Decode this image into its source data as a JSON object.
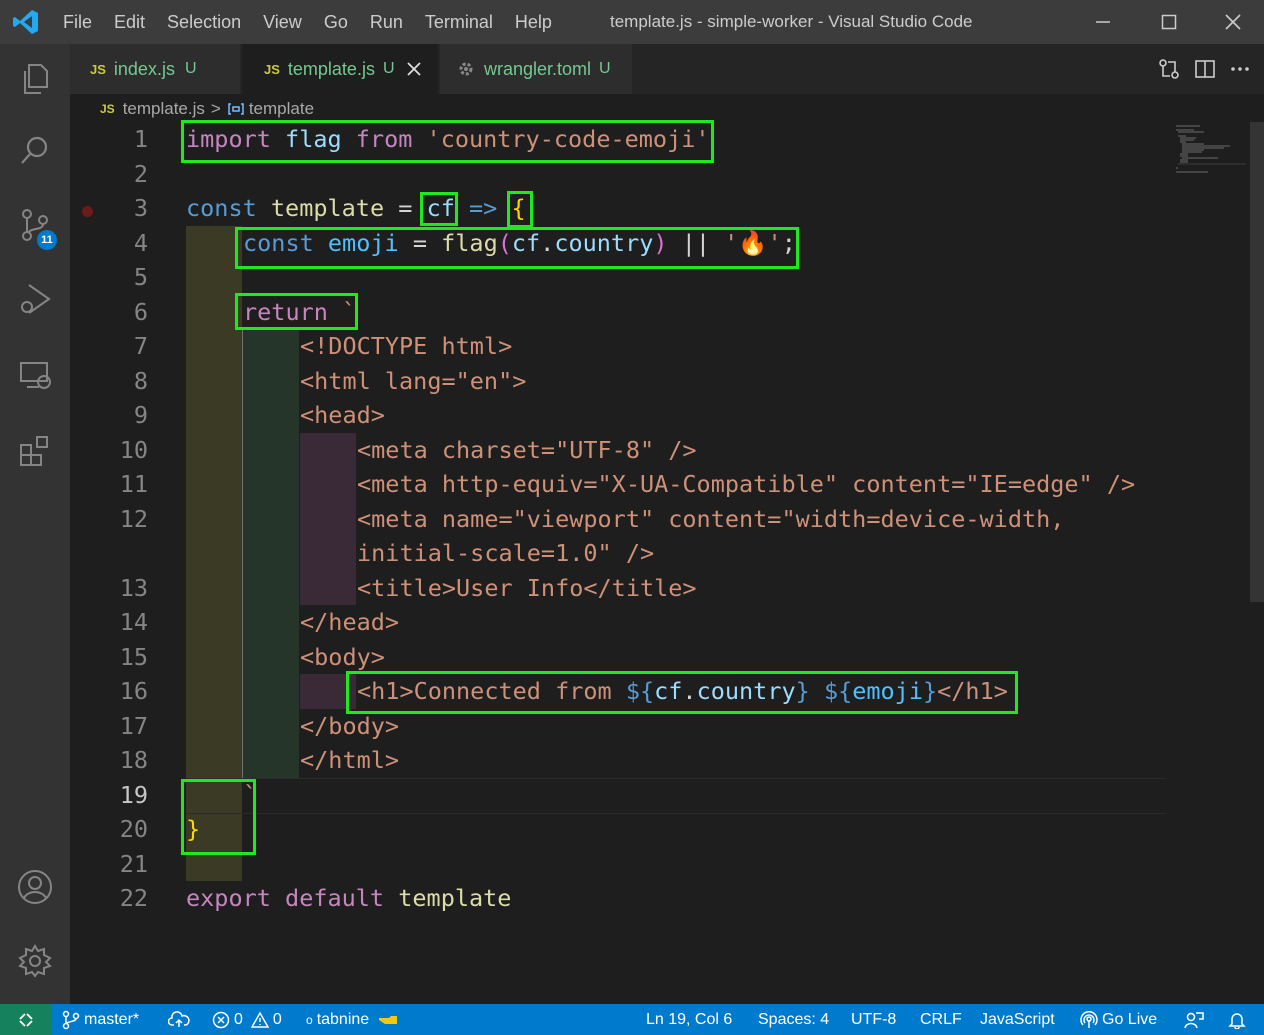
{
  "menu": [
    "File",
    "Edit",
    "Selection",
    "View",
    "Go",
    "Run",
    "Terminal",
    "Help"
  ],
  "window_title": "template.js - simple-worker - Visual Studio Code",
  "activity": {
    "scm_badge": "11"
  },
  "tabs": [
    {
      "icon": "JS",
      "label": "index.js",
      "status": "U"
    },
    {
      "icon": "JS",
      "label": "template.js",
      "status": "U"
    },
    {
      "icon": "gear",
      "label": "wrangler.toml",
      "status": "U"
    }
  ],
  "breadcrumb": {
    "file": "template.js",
    "separator": ">",
    "symbol": "template"
  },
  "editor": {
    "current_line": 19,
    "lines": [
      {
        "n": "1",
        "text": "import flag from 'country-code-emoji'"
      },
      {
        "n": "2",
        "text": ""
      },
      {
        "n": "3",
        "text": "const template = cf => {"
      },
      {
        "n": "4",
        "text": "const emoji = flag(cf.country) || '🔥';"
      },
      {
        "n": "5",
        "text": ""
      },
      {
        "n": "6",
        "text": "return `"
      },
      {
        "n": "7",
        "text": "<!DOCTYPE html>"
      },
      {
        "n": "8",
        "text": "<html lang=\"en\">"
      },
      {
        "n": "9",
        "text": "<head>"
      },
      {
        "n": "10",
        "text": "<meta charset=\"UTF-8\" />"
      },
      {
        "n": "11",
        "text": "<meta http-equiv=\"X-UA-Compatible\" content=\"IE=edge\" />"
      },
      {
        "n": "12",
        "text": "<meta name=\"viewport\" content=\"width=device-width,"
      },
      {
        "n": "",
        "text": "initial-scale=1.0\" />"
      },
      {
        "n": "13",
        "text": "<title>User Info</title>"
      },
      {
        "n": "14",
        "text": "</head>"
      },
      {
        "n": "15",
        "text": "<body>"
      },
      {
        "n": "16",
        "text": "<h1>Connected from ${cf.country} ${emoji}</h1>"
      },
      {
        "n": "17",
        "text": "</body>"
      },
      {
        "n": "18",
        "text": "</html>"
      },
      {
        "n": "19",
        "text": "`"
      },
      {
        "n": "20",
        "text": "}"
      },
      {
        "n": "21",
        "text": ""
      },
      {
        "n": "22",
        "text": "export default template"
      }
    ]
  },
  "status": {
    "branch": "master*",
    "errors": "0",
    "warnings": "0",
    "tabnine": "tabnine",
    "position": "Ln 19, Col 6",
    "spaces": "Spaces: 4",
    "encoding": "UTF-8",
    "eol": "CRLF",
    "language": "JavaScript",
    "golive": "Go Live"
  },
  "colors": {
    "statusbar": "#007acc",
    "highlight_box": "#1fe81f",
    "keyword": "#c586c0",
    "string": "#ce9178"
  }
}
